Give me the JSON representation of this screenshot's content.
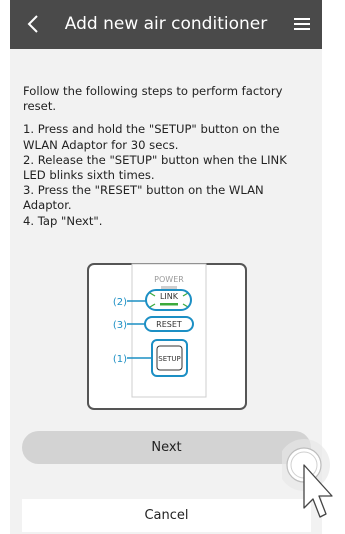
{
  "header": {
    "title": "Add new air conditioner",
    "back_icon": "chevron-left-icon",
    "menu_icon": "hamburger-menu-icon"
  },
  "instructions": {
    "intro": "Follow the following steps to perform factory reset.",
    "steps": [
      "1. Press and hold the \"SETUP\" button on the WLAN Adaptor for 30 secs.",
      "2. Release the \"SETUP\" button when the LINK LED blinks sixth times.",
      "3. Press the \"RESET\" button on the WLAN Adaptor.",
      "4. Tap \"Next\"."
    ]
  },
  "diagram": {
    "power_label": "POWER",
    "link_label": "LINK",
    "reset_label": "RESET",
    "setup_label": "SETUP",
    "callout_1": "(1)",
    "callout_2": "(2)",
    "callout_3": "(3)"
  },
  "buttons": {
    "next": "Next",
    "cancel": "Cancel"
  },
  "colors": {
    "header_bg": "#4a4a4a",
    "accent_blue": "#1c8fc4",
    "link_led": "#3caa3c",
    "button_gray": "#d3d3d3"
  }
}
